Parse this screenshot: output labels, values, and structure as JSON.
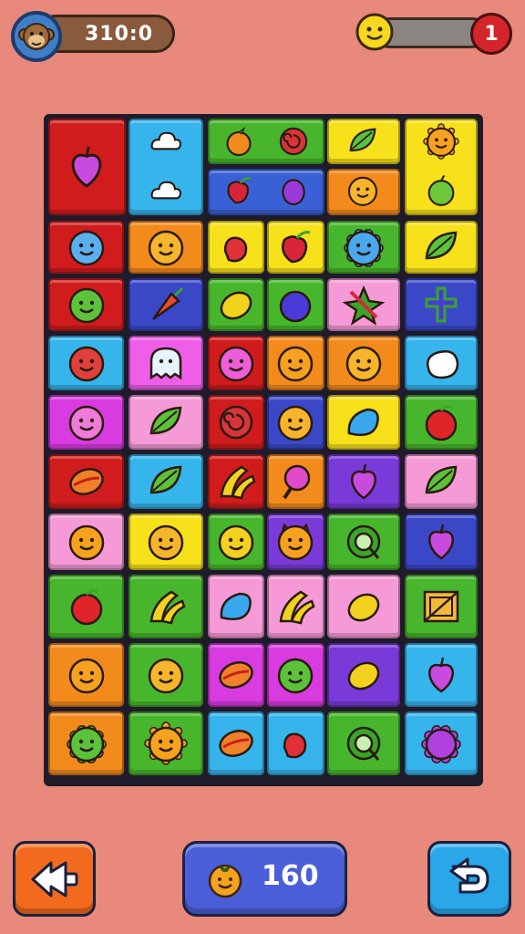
{
  "header": {
    "score": "310:0",
    "avatar_icon": "monkey-icon",
    "mood_icon": "smiley-icon",
    "lives": "1"
  },
  "board": {
    "tiles": [
      {
        "color": "#d01c1c",
        "icon": "plum"
      },
      {
        "color": "#36b4ec",
        "icon": "cloud"
      },
      {
        "color": "#47b62c",
        "icon": "orange-fruit"
      },
      {
        "color": "#47b62c",
        "icon": "swirl"
      },
      {
        "color": "#f7e11a",
        "icon": "leaf"
      },
      {
        "color": "#f7e11a",
        "icon": "sun-face"
      },
      {
        "color": "#36b4ec",
        "icon": "cloud"
      },
      {
        "color": "#3a60d6",
        "icon": "pepper"
      },
      {
        "color": "#3a60d6",
        "icon": "eggplant"
      },
      {
        "color": "#f28a1c",
        "icon": "smiley"
      },
      {
        "color": "#f7e11a",
        "icon": "green-apple"
      },
      {
        "color": "#d01c1c",
        "icon": "blue-blob"
      },
      {
        "color": "#f28a1c",
        "icon": "smiley"
      },
      {
        "color": "#f7e11a",
        "icon": "radish"
      },
      {
        "color": "#f7e11a",
        "icon": "pepper"
      },
      {
        "color": "#47b62c",
        "icon": "blue-gear"
      },
      {
        "color": "#f7e11a",
        "icon": "leaf"
      },
      {
        "color": "#d01c1c",
        "icon": "green-blob"
      },
      {
        "color": "#3a48c8",
        "icon": "carrot"
      },
      {
        "color": "#47b62c",
        "icon": "lemon"
      },
      {
        "color": "#47b62c",
        "icon": "berry"
      },
      {
        "color": "#f59ad6",
        "icon": "star-leaf"
      },
      {
        "color": "#3a48c8",
        "icon": "cross"
      },
      {
        "color": "#36b4ec",
        "icon": "tomato"
      },
      {
        "color": "#ee5ee8",
        "icon": "ghost"
      },
      {
        "color": "#d01c1c",
        "icon": "pink-ball"
      },
      {
        "color": "#f28a1c",
        "icon": "orange-face"
      },
      {
        "color": "#f28a1c",
        "icon": "smiley"
      },
      {
        "color": "#36b4ec",
        "icon": "white-blob"
      },
      {
        "color": "#d83be0",
        "icon": "pink-face"
      },
      {
        "color": "#f59ad6",
        "icon": "leaf"
      },
      {
        "color": "#d01c1c",
        "icon": "swirl"
      },
      {
        "color": "#3a48c8",
        "icon": "smiley"
      },
      {
        "color": "#f7e11a",
        "icon": "blue-drop"
      },
      {
        "color": "#47b62c",
        "icon": "apple"
      },
      {
        "color": "#d01c1c",
        "icon": "mango"
      },
      {
        "color": "#36b4ec",
        "icon": "leaf"
      },
      {
        "color": "#d01c1c",
        "icon": "banana"
      },
      {
        "color": "#f28a1c",
        "icon": "pink-bulb"
      },
      {
        "color": "#7a3ad8",
        "icon": "plum"
      },
      {
        "color": "#f59ad6",
        "icon": "leaf"
      },
      {
        "color": "#f59ad6",
        "icon": "orange-face"
      },
      {
        "color": "#f7e11a",
        "icon": "smiley"
      },
      {
        "color": "#47b62c",
        "icon": "lemon-face"
      },
      {
        "color": "#7a3ad8",
        "icon": "cat-face"
      },
      {
        "color": "#47b62c",
        "icon": "ring"
      },
      {
        "color": "#3a48c8",
        "icon": "plum"
      },
      {
        "color": "#47b62c",
        "icon": "apple"
      },
      {
        "color": "#47b62c",
        "icon": "banana"
      },
      {
        "color": "#f59ad6",
        "icon": "blue-drop"
      },
      {
        "color": "#f59ad6",
        "icon": "banana"
      },
      {
        "color": "#f59ad6",
        "icon": "lemon"
      },
      {
        "color": "#47b62c",
        "icon": "crate"
      },
      {
        "color": "#f28a1c",
        "icon": "orange-face"
      },
      {
        "color": "#47b62c",
        "icon": "smiley"
      },
      {
        "color": "#d83be0",
        "icon": "mango"
      },
      {
        "color": "#d83be0",
        "icon": "green-blob"
      },
      {
        "color": "#7a3ad8",
        "icon": "lemon"
      },
      {
        "color": "#36b4ec",
        "icon": "plum"
      },
      {
        "color": "#f28a1c",
        "icon": "green-gear"
      },
      {
        "color": "#47b62c",
        "icon": "sun-face"
      },
      {
        "color": "#36b4ec",
        "icon": "mango"
      },
      {
        "color": "#36b4ec",
        "icon": "radish"
      },
      {
        "color": "#47b62c",
        "icon": "ring"
      },
      {
        "color": "#36b4ec",
        "icon": "purple-gear"
      }
    ]
  },
  "footer": {
    "back_icon": "rewind-icon",
    "moves_icon": "orange-face-icon",
    "moves_count": "160",
    "undo_icon": "undo-arrow-icon"
  }
}
